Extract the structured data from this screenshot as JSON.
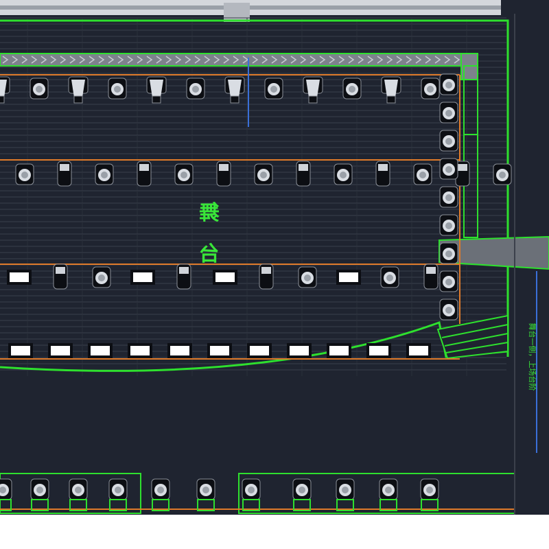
{
  "plan": {
    "stage_label_line1": "舞",
    "stage_label_line2": "台",
    "side_note": "舞台一侧，上场台阶",
    "rows": [
      {
        "pattern": [
          "beam",
          "spot",
          "beam",
          "spot",
          "beam",
          "spot",
          "beam",
          "spot",
          "beam",
          "spot",
          "beam",
          "spot"
        ]
      },
      {
        "pattern": [
          "spot",
          "wash",
          "spot",
          "wash",
          "spot",
          "wash",
          "spot",
          "wash",
          "spot",
          "wash",
          "spot",
          "wash",
          "spot"
        ]
      },
      {
        "pattern": [
          "flood",
          "wash",
          "spot",
          "flood",
          "wash",
          "flood",
          "wash",
          "spot",
          "flood",
          "spot",
          "wash"
        ]
      },
      {
        "pattern": [
          "flood",
          "flood",
          "flood",
          "flood",
          "flood",
          "flood",
          "flood",
          "flood",
          "flood",
          "flood",
          "flood"
        ]
      }
    ],
    "side_column": [
      "spot",
      "wash",
      "spot",
      "wash",
      "spot",
      "wash",
      "spot",
      "wash",
      "spot"
    ],
    "front_row_count": 11
  },
  "colors": {
    "background": "#1f2430",
    "outline": "#2ee02e",
    "truss": "#e07b2a",
    "plank": "#3a3f4c",
    "fixture_dark": "#0c0e13",
    "fixture_light": "#d9dde3"
  }
}
